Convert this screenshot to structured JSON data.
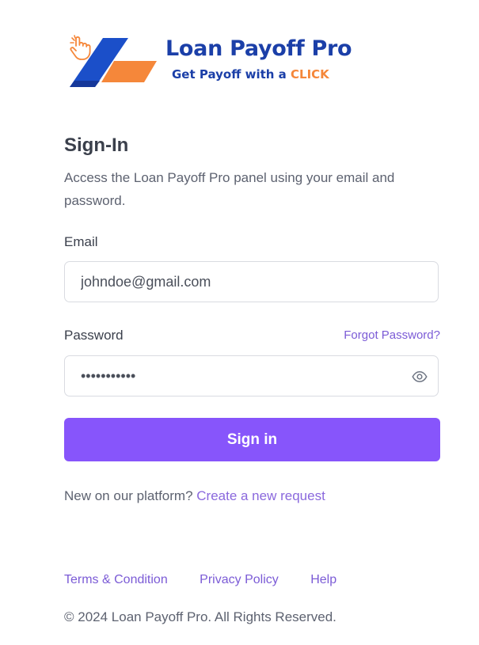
{
  "logo": {
    "title": "Loan Payoff Pro",
    "tagline_prefix": "Get Payoff with a ",
    "tagline_highlight": "CLICK",
    "colors": {
      "blue": "#1b3fa8",
      "orange": "#f5873a"
    }
  },
  "page": {
    "title": "Sign-In",
    "subtitle": "Access the Loan Payoff Pro panel using your email and password."
  },
  "form": {
    "email_label": "Email",
    "email_value": "johndoe@gmail.com",
    "password_label": "Password",
    "password_value": "johndoe1234",
    "forgot_label": "Forgot Password?",
    "eye_icon": "eye-icon",
    "submit_label": "Sign in"
  },
  "signup": {
    "prompt": "New on our platform? ",
    "link": "Create a new request"
  },
  "footer": {
    "links": [
      "Terms & Condition",
      "Privacy Policy",
      "Help"
    ],
    "copyright": "© 2024 Loan Payoff Pro. All Rights Reserved."
  },
  "colors": {
    "primary": "#8755fb",
    "link": "#7b5bd6"
  }
}
